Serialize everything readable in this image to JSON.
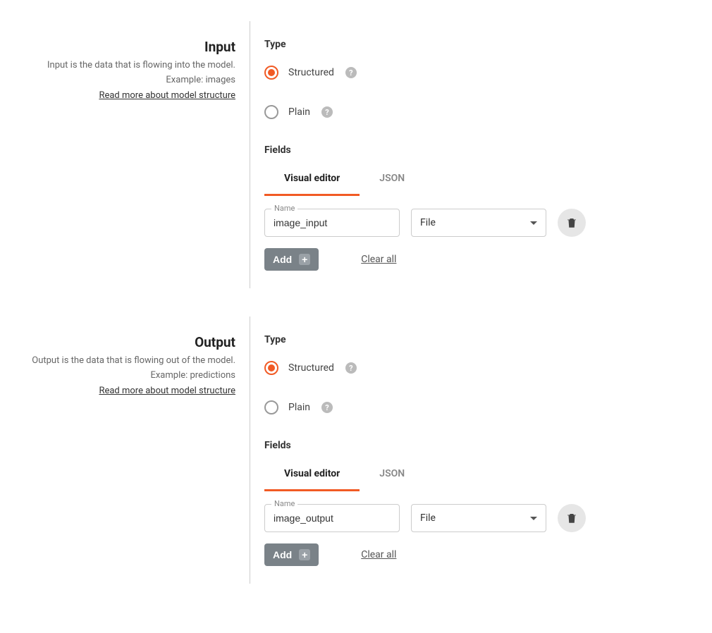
{
  "input": {
    "title": "Input",
    "description": "Input is the data that is flowing into the model.",
    "example": "Example: images",
    "readmore": "Read more about model structure",
    "type_label": "Type",
    "type_options": {
      "structured": "Structured",
      "plain": "Plain"
    },
    "fields_label": "Fields",
    "tabs": {
      "visual": "Visual editor",
      "json": "JSON"
    },
    "field": {
      "name_label": "Name",
      "name_value": "image_input",
      "type_value": "File"
    },
    "add_label": "Add",
    "clear_label": "Clear all"
  },
  "output": {
    "title": "Output",
    "description": "Output is the data that is flowing out of the model.",
    "example": "Example: predictions",
    "readmore": "Read more about model structure",
    "type_label": "Type",
    "type_options": {
      "structured": "Structured",
      "plain": "Plain"
    },
    "fields_label": "Fields",
    "tabs": {
      "visual": "Visual editor",
      "json": "JSON"
    },
    "field": {
      "name_label": "Name",
      "name_value": "image_output",
      "type_value": "File"
    },
    "add_label": "Add",
    "clear_label": "Clear all"
  }
}
